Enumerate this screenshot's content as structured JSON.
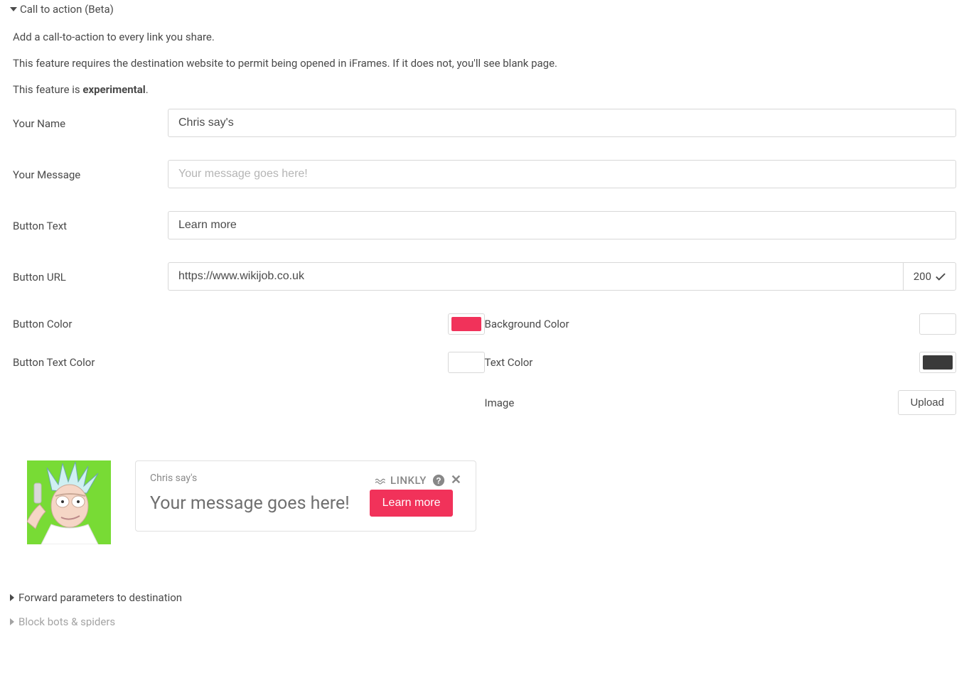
{
  "section": {
    "title": "Call to action (Beta)",
    "desc1": "Add a call-to-action to every link you share.",
    "desc2": "This feature requires the destination website to permit being opened in iFrames. If it does not, you'll see blank page.",
    "desc3_prefix": "This feature is ",
    "desc3_bold": "experimental",
    "desc3_suffix": "."
  },
  "fields": {
    "your_name": {
      "label": "Your Name",
      "value": "Chris say's"
    },
    "your_message": {
      "label": "Your Message",
      "placeholder": "Your message goes here!"
    },
    "button_text": {
      "label": "Button Text",
      "value": "Learn more"
    },
    "button_url": {
      "label": "Button URL",
      "value": "https://www.wikijob.co.uk",
      "status": "200"
    }
  },
  "colors": {
    "button_color": {
      "label": "Button Color",
      "value": "#f1325a"
    },
    "button_text_color": {
      "label": "Button Text Color",
      "value": "#ffffff"
    },
    "background_color": {
      "label": "Background Color",
      "value": "#ffffff"
    },
    "text_color": {
      "label": "Text Color",
      "value": "#3a3a3a"
    },
    "image": {
      "label": "Image",
      "button": "Upload"
    }
  },
  "preview": {
    "name": "Chris say's",
    "message": "Your message goes here!",
    "button": "Learn more",
    "brand": "LINKLY"
  },
  "collapsed": {
    "forward_params": "Forward parameters to destination",
    "blocked": "Block bots & spiders"
  }
}
